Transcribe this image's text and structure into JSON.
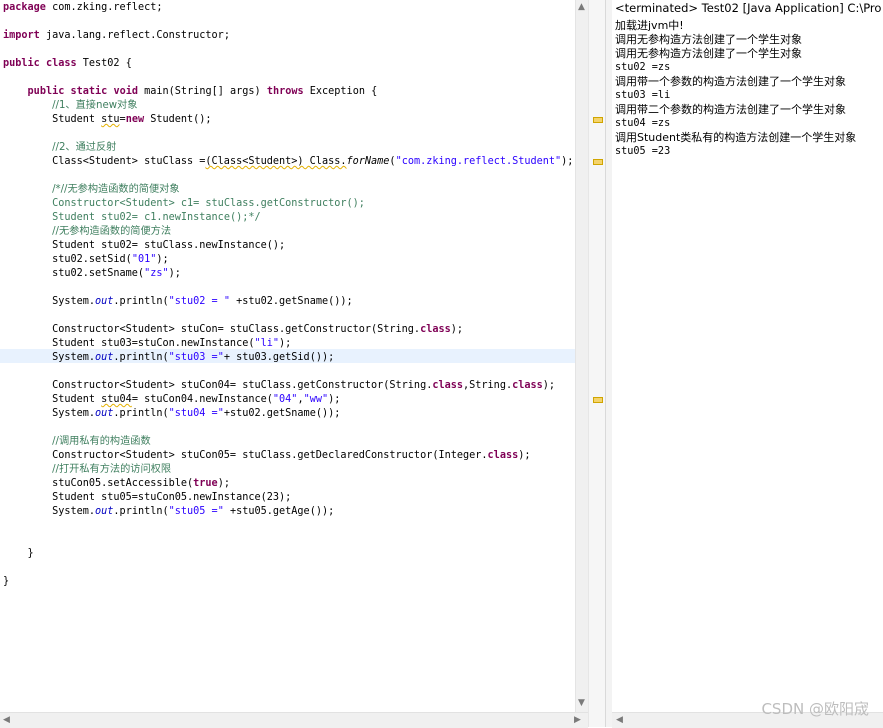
{
  "editor": {
    "lines": [
      {
        "row": 0,
        "tokens": [
          {
            "t": "package",
            "c": "kw"
          },
          {
            "t": " com.zking.reflect;"
          }
        ]
      },
      {
        "row": 2,
        "tokens": [
          {
            "t": "import",
            "c": "kw"
          },
          {
            "t": " java.lang.reflect.Constructor;"
          }
        ]
      },
      {
        "row": 4,
        "tokens": [
          {
            "t": "public",
            "c": "kw"
          },
          {
            "t": " "
          },
          {
            "t": "class",
            "c": "kw"
          },
          {
            "t": " Test02 {"
          }
        ]
      },
      {
        "row": 6,
        "tokens": [
          {
            "t": "    "
          },
          {
            "t": "public",
            "c": "kw"
          },
          {
            "t": " "
          },
          {
            "t": "static",
            "c": "kw"
          },
          {
            "t": " "
          },
          {
            "t": "void",
            "c": "kw"
          },
          {
            "t": " main(String[] args) "
          },
          {
            "t": "throws",
            "c": "kw"
          },
          {
            "t": " Exception {"
          }
        ]
      },
      {
        "row": 7,
        "tokens": [
          {
            "t": "        "
          },
          {
            "t": "//1、直接new对象",
            "c": "cm cjk"
          }
        ]
      },
      {
        "row": 8,
        "tokens": [
          {
            "t": "        Student "
          },
          {
            "t": "stu",
            "c": "warn"
          },
          {
            "t": "="
          },
          {
            "t": "new",
            "c": "kw"
          },
          {
            "t": " Student();"
          }
        ]
      },
      {
        "row": 10,
        "tokens": [
          {
            "t": "        "
          },
          {
            "t": "//2、通过反射",
            "c": "cm cjk"
          }
        ]
      },
      {
        "row": 11,
        "tokens": [
          {
            "t": "        Class<Student> stuClass ="
          },
          {
            "t": "(Class<Student>) Class.",
            "c": "warn"
          },
          {
            "t": "forName",
            "c": "sm"
          },
          {
            "t": "(",
            "c": ""
          },
          {
            "t": "\"com.zking.reflect.Student\"",
            "c": "str"
          },
          {
            "t": ");"
          }
        ]
      },
      {
        "row": 13,
        "tokens": [
          {
            "t": "        "
          },
          {
            "t": "/*//无参构造函数的简便对象",
            "c": "cm cjk"
          }
        ]
      },
      {
        "row": 14,
        "tokens": [
          {
            "t": "        "
          },
          {
            "t": "Constructor<Student> c1= stuClass.getConstructor();",
            "c": "cm"
          }
        ]
      },
      {
        "row": 15,
        "tokens": [
          {
            "t": "        "
          },
          {
            "t": "Student stu02= c1.newInstance();*/",
            "c": "cm"
          }
        ]
      },
      {
        "row": 16,
        "tokens": [
          {
            "t": "        "
          },
          {
            "t": "//无参构造函数的简便方法",
            "c": "cm cjk"
          }
        ]
      },
      {
        "row": 17,
        "tokens": [
          {
            "t": "        Student stu02= stuClass.newInstance();"
          }
        ]
      },
      {
        "row": 18,
        "tokens": [
          {
            "t": "        stu02.setSid("
          },
          {
            "t": "\"01\"",
            "c": "str"
          },
          {
            "t": ");"
          }
        ]
      },
      {
        "row": 19,
        "tokens": [
          {
            "t": "        stu02.setSname("
          },
          {
            "t": "\"zs\"",
            "c": "str"
          },
          {
            "t": ");"
          }
        ]
      },
      {
        "row": 21,
        "tokens": [
          {
            "t": "        System."
          },
          {
            "t": "out",
            "c": "fld"
          },
          {
            "t": ".println("
          },
          {
            "t": "\"stu02 = \"",
            "c": "str"
          },
          {
            "t": " +stu02.getSname());"
          }
        ]
      },
      {
        "row": 23,
        "tokens": [
          {
            "t": "        Constructor<Student> stuCon= stuClass.getConstructor(String."
          },
          {
            "t": "class",
            "c": "kw"
          },
          {
            "t": ");"
          }
        ]
      },
      {
        "row": 24,
        "tokens": [
          {
            "t": "        Student stu03=stuCon.newInstance("
          },
          {
            "t": "\"li\"",
            "c": "str"
          },
          {
            "t": ");"
          }
        ]
      },
      {
        "row": 25,
        "tokens": [
          {
            "t": "        System."
          },
          {
            "t": "out",
            "c": "fld"
          },
          {
            "t": ".println("
          },
          {
            "t": "\"stu03 =\"",
            "c": "str"
          },
          {
            "t": "+ stu03.getSid());"
          }
        ]
      },
      {
        "row": 27,
        "tokens": [
          {
            "t": "        Constructor<Student> stuCon04= stuClass.getConstructor(String."
          },
          {
            "t": "class",
            "c": "kw"
          },
          {
            "t": ",String."
          },
          {
            "t": "class",
            "c": "kw"
          },
          {
            "t": ");"
          }
        ]
      },
      {
        "row": 28,
        "tokens": [
          {
            "t": "        Student "
          },
          {
            "t": "stu04",
            "c": "warn"
          },
          {
            "t": "= stuCon04.newInstance("
          },
          {
            "t": "\"04\"",
            "c": "str"
          },
          {
            "t": ","
          },
          {
            "t": "\"ww\"",
            "c": "str"
          },
          {
            "t": ");"
          }
        ]
      },
      {
        "row": 29,
        "tokens": [
          {
            "t": "        System."
          },
          {
            "t": "out",
            "c": "fld"
          },
          {
            "t": ".println("
          },
          {
            "t": "\"stu04 =\"",
            "c": "str"
          },
          {
            "t": "+stu02.getSname());"
          }
        ]
      },
      {
        "row": 31,
        "tokens": [
          {
            "t": "        "
          },
          {
            "t": "//调用私有的构造函数",
            "c": "cm cjk"
          }
        ]
      },
      {
        "row": 32,
        "tokens": [
          {
            "t": "        Constructor<Student> stuCon05= stuClass.getDeclaredConstructor(Integer."
          },
          {
            "t": "class",
            "c": "kw"
          },
          {
            "t": ");"
          }
        ]
      },
      {
        "row": 33,
        "tokens": [
          {
            "t": "        "
          },
          {
            "t": "//打开私有方法的访问权限",
            "c": "cm cjk"
          }
        ]
      },
      {
        "row": 34,
        "tokens": [
          {
            "t": "        stuCon05.setAccessible("
          },
          {
            "t": "true",
            "c": "kw"
          },
          {
            "t": ");"
          }
        ]
      },
      {
        "row": 35,
        "tokens": [
          {
            "t": "        Student stu05=stuCon05.newInstance(23);"
          }
        ]
      },
      {
        "row": 36,
        "tokens": [
          {
            "t": "        System."
          },
          {
            "t": "out",
            "c": "fld"
          },
          {
            "t": ".println("
          },
          {
            "t": "\"stu05 =\"",
            "c": "str"
          },
          {
            "t": " +stu05.getAge());"
          }
        ]
      },
      {
        "row": 39,
        "tokens": [
          {
            "t": "    }"
          }
        ]
      },
      {
        "row": 41,
        "tokens": [
          {
            "t": "}"
          }
        ]
      }
    ]
  },
  "console": {
    "title": "<terminated> Test02 [Java Application] C:\\Pro",
    "lines": [
      {
        "text": "加载进jvm中!",
        "cjk": true
      },
      {
        "text": "调用无参构造方法创建了一个学生对象",
        "cjk": true
      },
      {
        "text": "调用无参构造方法创建了一个学生对象",
        "cjk": true
      },
      {
        "text": "stu02 =zs",
        "cjk": false
      },
      {
        "text": "调用带一个参数的构造方法创建了一个学生对象",
        "cjk": true
      },
      {
        "text": "stu03 =li",
        "cjk": false
      },
      {
        "text": "调用带二个参数的构造方法创建了一个学生对象",
        "cjk": true
      },
      {
        "text": "stu04 =zs",
        "cjk": false
      },
      {
        "text": "调用Student类私有的构造方法创建一个学生对象",
        "cjk": true
      },
      {
        "text": "stu05 =23",
        "cjk": false
      }
    ]
  },
  "scroll_arrows": {
    "up": "▲",
    "down": "▼",
    "left": "◀",
    "right": "▶"
  },
  "watermark": "CSDN @欧阳宬"
}
